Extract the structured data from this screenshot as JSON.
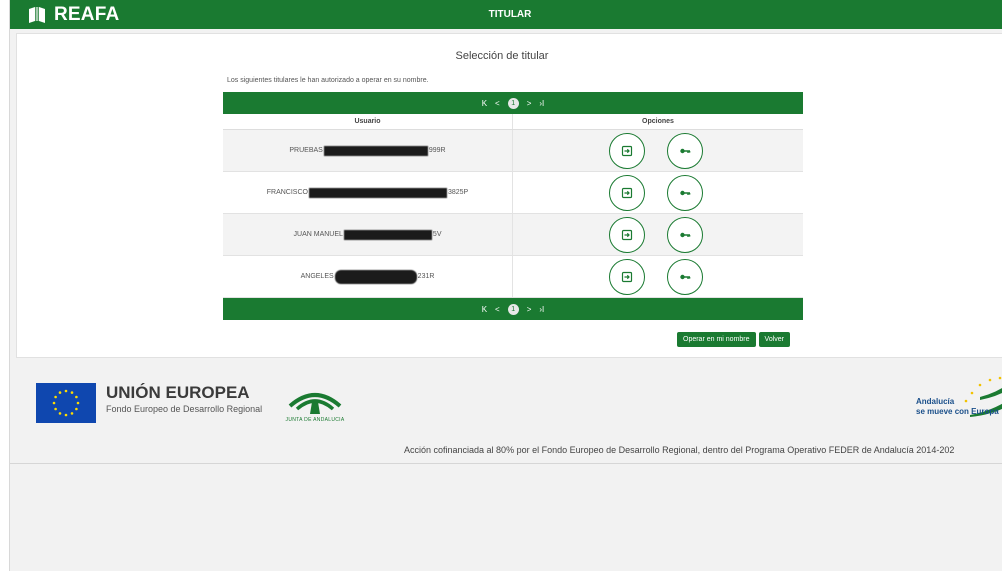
{
  "app": {
    "brand": "REAFA",
    "page_title": "TITULAR"
  },
  "card": {
    "title": "Selección de titular",
    "intro": "Los siguientes titulares le han autorizado a operar en su nombre."
  },
  "pager": {
    "first": "K",
    "prev": "<",
    "current": "1",
    "next": ">",
    "last": "›I"
  },
  "table": {
    "headers": [
      "Usuario",
      "Opciones"
    ],
    "rows": [
      {
        "prefix": "PRUEBAS",
        "suffix": "999R"
      },
      {
        "prefix": "FRANCISCO",
        "suffix": "3825P"
      },
      {
        "prefix": "JUAN MANUEL",
        "suffix": "5V"
      },
      {
        "prefix": "ANGELES",
        "suffix": "231R"
      }
    ]
  },
  "actions": {
    "operate": "Operar en mi nombre",
    "back": "Volver"
  },
  "footer": {
    "eu_title": "UNIÓN EUROPEA",
    "eu_subtitle": "Fondo Europeo de Desarrollo Regional",
    "junta": "JUNTA DE ANDALUCIA",
    "andalucia_line1": "Andalucía",
    "andalucia_line2": "se mueve con Europa",
    "cofinancing": "Acción cofinanciada al 80% por el Fondo Europeo de Desarrollo Regional, dentro del Programa Operativo FEDER de Andalucía 2014-202"
  },
  "colors": {
    "primary": "#1a7a31",
    "eu_blue": "#0f47af"
  },
  "icons": {
    "brand": "book-icon",
    "operate": "login-icon",
    "permissions": "key-icon"
  }
}
